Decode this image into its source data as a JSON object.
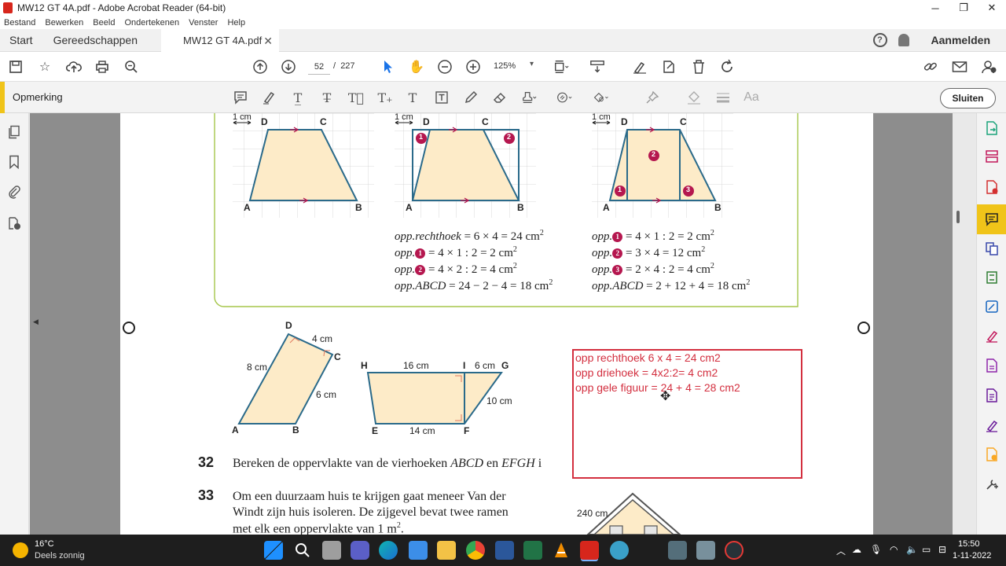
{
  "window": {
    "title": "MW12 GT 4A.pdf - Adobe Acrobat Reader (64-bit)",
    "minimize": "─",
    "maximize": "❐",
    "close": "✕"
  },
  "menu": [
    "Bestand",
    "Bewerken",
    "Beeld",
    "Ondertekenen",
    "Venster",
    "Help"
  ],
  "tabs": {
    "start": "Start",
    "tools": "Gereedschappen",
    "document": "MW12 GT 4A.pdf",
    "help_glyph": "?",
    "login": "Aanmelden"
  },
  "toolbar": {
    "current_page": "52",
    "page_separator": "/",
    "total_pages": "227",
    "zoom": "125%"
  },
  "comment_bar": {
    "label": "Opmerking",
    "close": "Sluiten"
  },
  "page": {
    "figures": {
      "unit_label": "1 cm",
      "vertices_top": [
        "D",
        "C",
        "A",
        "B"
      ],
      "badges": [
        "1",
        "2",
        "3"
      ],
      "fig_abcd": {
        "A": "A",
        "B": "B",
        "C": "C",
        "D": "D",
        "ad": "8 cm",
        "dc": "4 cm",
        "cb": "6 cm"
      },
      "fig_efgh": {
        "E": "E",
        "F": "F",
        "G": "G",
        "H": "H",
        "I": "I",
        "hi": "16 cm",
        "ig": "6 cm",
        "gf": "10 cm",
        "ef": "14 cm"
      }
    },
    "calc_left": [
      {
        "pre": "",
        "name": "opp.rechthoek",
        "badge": "",
        "expr": " = 6 × 4 = 24 cm",
        "sup": "2"
      },
      {
        "pre": "opp.",
        "name": "",
        "badge": "1",
        "expr": " = 4 × 1 : 2 = 2 cm",
        "sup": "2"
      },
      {
        "pre": "opp.",
        "name": "",
        "badge": "2",
        "expr": " = 4 × 2 : 2 = 4 cm",
        "sup": "2"
      },
      {
        "pre": "",
        "name": "opp.ABCD",
        "badge": "",
        "expr": " = 24 − 2 − 4 = 18 cm",
        "sup": "2"
      }
    ],
    "calc_right": [
      {
        "pre": "opp.",
        "name": "",
        "badge": "1",
        "expr": " = 4 × 1 : 2 = 2 cm",
        "sup": "2"
      },
      {
        "pre": "opp.",
        "name": "",
        "badge": "2",
        "expr": " = 3 × 4 = 12 cm",
        "sup": "2"
      },
      {
        "pre": "opp.",
        "name": "",
        "badge": "3",
        "expr": " = 2 × 4 : 2 = 4 cm",
        "sup": "2"
      },
      {
        "pre": "",
        "name": "opp.ABCD",
        "badge": "",
        "expr": " = 2 + 12 + 4 = 18 cm",
        "sup": "2"
      }
    ],
    "exercise_32": {
      "number": "32",
      "text_a": "Bereken de oppervlakte van de vierhoeken ",
      "abcd": "ABCD",
      "text_b": " en ",
      "efgh": "EFGH",
      "text_c": " i"
    },
    "exercise_33": {
      "number": "33",
      "line1": "Om een duurzaam huis te krijgen gaat meneer Van der",
      "line2": "Windt zijn huis isoleren. De zijgevel bevat twee ramen",
      "line3": "met elk een oppervlakte van 1 m",
      "line3_sup": "2",
      "line3_end": ".",
      "house_label": "240 cm"
    },
    "note": {
      "lines": [
        "opp rechthoek 6 x 4 = 24 cm2",
        "opp driehoek = 4x2:2= 4 cm2",
        "opp gele figuur = 24 + 4 = 28 cm2"
      ]
    }
  },
  "taskbar": {
    "temperature": "16°C",
    "weather": "Deels zonnig",
    "time": "15:50",
    "date": "1-11-2022"
  },
  "colors": {
    "accent_yellow": "#f0c419",
    "note_red": "#d32f3f",
    "figure_fill": "#fdebc8",
    "figure_stroke": "#2a6a8a",
    "badge": "#b5174f",
    "frame_green": "#a5c64a"
  }
}
